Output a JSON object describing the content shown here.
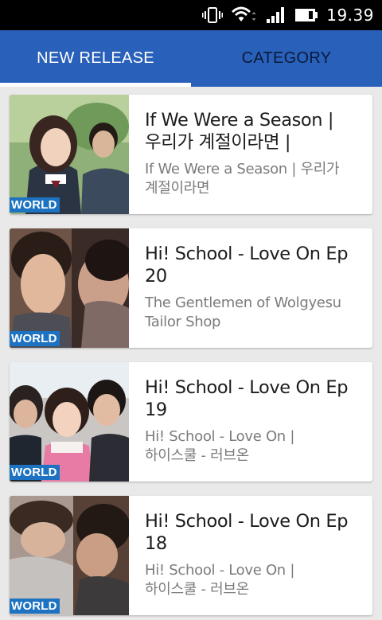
{
  "status_bar": {
    "time": "19.39",
    "icons": [
      "vibrate-icon",
      "wifi-icon",
      "signal-icon",
      "battery-icon"
    ]
  },
  "tabs": [
    {
      "label": "NEW RELEASE",
      "selected": true
    },
    {
      "label": "CATEGORY",
      "selected": false
    }
  ],
  "colors": {
    "tab_bar": "#2960b9",
    "badge": "#1d73c2",
    "list_background": "#e9e9e9"
  },
  "items": [
    {
      "badge": "WORLD",
      "title_line1": "If We Were a Season |",
      "title_line2": "우리가 계절이라면 |",
      "sub_line1": "If We Were a Season | 우리가",
      "sub_line2": "계절이라면"
    },
    {
      "badge": "WORLD",
      "title_line1": "Hi! School - Love On Ep",
      "title_line2": "20",
      "sub_line1": "The Gentlemen of Wolgyesu",
      "sub_line2": "Tailor Shop"
    },
    {
      "badge": "WORLD",
      "title_line1": "Hi! School - Love On Ep",
      "title_line2": "19",
      "sub_line1": "Hi! School - Love On |",
      "sub_line2": "하이스쿨 - 러브온"
    },
    {
      "badge": "WORLD",
      "title_line1": "Hi! School - Love On Ep",
      "title_line2": "18",
      "sub_line1": "Hi! School - Love On |",
      "sub_line2": "하이스쿨 - 러브온"
    }
  ]
}
